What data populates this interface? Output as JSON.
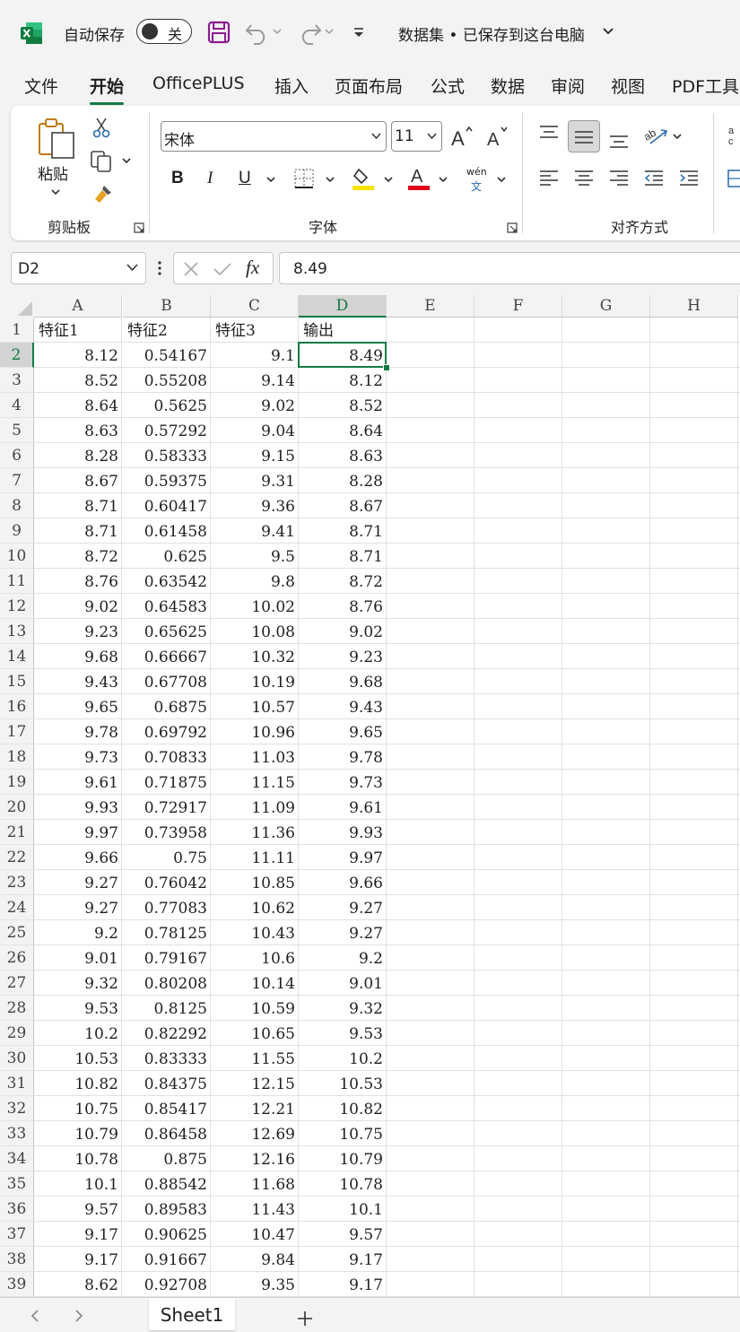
{
  "titlebar": {
    "autosave_label": "自动保存",
    "autosave_state": "关",
    "document_title": "数据集 • 已保存到这台电脑"
  },
  "tabs": [
    "文件",
    "开始",
    "OfficePLUS",
    "插入",
    "页面布局",
    "公式",
    "数据",
    "审阅",
    "视图",
    "PDF工具"
  ],
  "active_tab": "开始",
  "ribbon": {
    "clipboard": {
      "paste_label": "粘贴",
      "group_label": "剪贴板"
    },
    "font": {
      "font_name": "宋体",
      "font_size": "11",
      "phonetic_top": "wén",
      "phonetic_bottom": "文",
      "group_label": "字体",
      "bold": "B",
      "italic": "I",
      "underline": "U",
      "highlight_color": "#f5e400",
      "font_color": "#e0001b"
    },
    "alignment": {
      "group_label": "对齐方式"
    }
  },
  "formula_bar": {
    "name_box": "D2",
    "fx": "fx",
    "formula": "8.49"
  },
  "accent_color": "#127a43",
  "grid": {
    "columns": [
      "A",
      "B",
      "C",
      "D",
      "E",
      "F",
      "G",
      "H"
    ],
    "selected_column": "D",
    "selected_row": 2,
    "headers": [
      "特征1",
      "特征2",
      "特征3",
      "输出"
    ],
    "rows": [
      [
        "8.12",
        "0.54167",
        "9.1",
        "8.49"
      ],
      [
        "8.52",
        "0.55208",
        "9.14",
        "8.12"
      ],
      [
        "8.64",
        "0.5625",
        "9.02",
        "8.52"
      ],
      [
        "8.63",
        "0.57292",
        "9.04",
        "8.64"
      ],
      [
        "8.28",
        "0.58333",
        "9.15",
        "8.63"
      ],
      [
        "8.67",
        "0.59375",
        "9.31",
        "8.28"
      ],
      [
        "8.71",
        "0.60417",
        "9.36",
        "8.67"
      ],
      [
        "8.71",
        "0.61458",
        "9.41",
        "8.71"
      ],
      [
        "8.72",
        "0.625",
        "9.5",
        "8.71"
      ],
      [
        "8.76",
        "0.63542",
        "9.8",
        "8.72"
      ],
      [
        "9.02",
        "0.64583",
        "10.02",
        "8.76"
      ],
      [
        "9.23",
        "0.65625",
        "10.08",
        "9.02"
      ],
      [
        "9.68",
        "0.66667",
        "10.32",
        "9.23"
      ],
      [
        "9.43",
        "0.67708",
        "10.19",
        "9.68"
      ],
      [
        "9.65",
        "0.6875",
        "10.57",
        "9.43"
      ],
      [
        "9.78",
        "0.69792",
        "10.96",
        "9.65"
      ],
      [
        "9.73",
        "0.70833",
        "11.03",
        "9.78"
      ],
      [
        "9.61",
        "0.71875",
        "11.15",
        "9.73"
      ],
      [
        "9.93",
        "0.72917",
        "11.09",
        "9.61"
      ],
      [
        "9.97",
        "0.73958",
        "11.36",
        "9.93"
      ],
      [
        "9.66",
        "0.75",
        "11.11",
        "9.97"
      ],
      [
        "9.27",
        "0.76042",
        "10.85",
        "9.66"
      ],
      [
        "9.27",
        "0.77083",
        "10.62",
        "9.27"
      ],
      [
        "9.2",
        "0.78125",
        "10.43",
        "9.27"
      ],
      [
        "9.01",
        "0.79167",
        "10.6",
        "9.2"
      ],
      [
        "9.32",
        "0.80208",
        "10.14",
        "9.01"
      ],
      [
        "9.53",
        "0.8125",
        "10.59",
        "9.32"
      ],
      [
        "10.2",
        "0.82292",
        "10.65",
        "9.53"
      ],
      [
        "10.53",
        "0.83333",
        "11.55",
        "10.2"
      ],
      [
        "10.82",
        "0.84375",
        "12.15",
        "10.53"
      ],
      [
        "10.75",
        "0.85417",
        "12.21",
        "10.82"
      ],
      [
        "10.79",
        "0.86458",
        "12.69",
        "10.75"
      ],
      [
        "10.78",
        "0.875",
        "12.16",
        "10.79"
      ],
      [
        "10.1",
        "0.88542",
        "11.68",
        "10.78"
      ],
      [
        "9.57",
        "0.89583",
        "11.43",
        "10.1"
      ],
      [
        "9.17",
        "0.90625",
        "10.47",
        "9.57"
      ],
      [
        "9.17",
        "0.91667",
        "9.84",
        "9.17"
      ],
      [
        "8.62",
        "0.92708",
        "9.35",
        "9.17"
      ]
    ]
  },
  "sheets": [
    "Sheet1"
  ],
  "active_sheet": "Sheet1"
}
